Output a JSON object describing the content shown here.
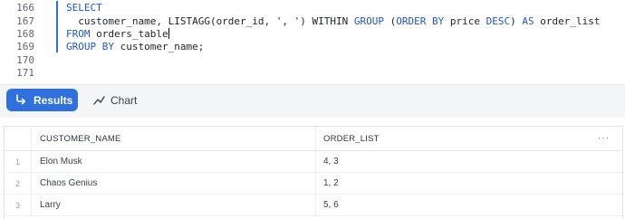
{
  "editor": {
    "line_numbers": [
      "166",
      "167",
      "168",
      "169",
      "170",
      "171"
    ],
    "lines": [
      [
        {
          "t": "SELECT",
          "k": true
        }
      ],
      [
        {
          "t": "  customer_name, LISTAGG(order_id, ', ') WITHIN ",
          "k": false
        },
        {
          "t": "GROUP",
          "k": true
        },
        {
          "t": " (",
          "k": false
        },
        {
          "t": "ORDER",
          "k": true
        },
        {
          "t": " ",
          "k": false
        },
        {
          "t": "BY",
          "k": true
        },
        {
          "t": " price ",
          "k": false
        },
        {
          "t": "DESC",
          "k": true
        },
        {
          "t": ") ",
          "k": false
        },
        {
          "t": "AS",
          "k": true
        },
        {
          "t": " order_list",
          "k": false
        }
      ],
      [
        {
          "t": "FROM",
          "k": true
        },
        {
          "t": " orders_table",
          "k": false
        }
      ],
      [
        {
          "t": "GROUP",
          "k": true
        },
        {
          "t": " ",
          "k": false
        },
        {
          "t": "BY",
          "k": true
        },
        {
          "t": " customer_name;",
          "k": false
        }
      ],
      [],
      []
    ],
    "cursor_line": 2,
    "keyword_color": "#1f57c8"
  },
  "tabs": {
    "results_label": "Results",
    "chart_label": "Chart",
    "active_tab": "Results",
    "accent_color": "#2f6fde"
  },
  "table": {
    "columns": [
      "CUSTOMER_NAME",
      "ORDER_LIST"
    ],
    "more_label": "···",
    "rows": [
      {
        "n": "1",
        "customer_name": "Elon Musk",
        "order_list": "4, 3"
      },
      {
        "n": "2",
        "customer_name": "Chaos Genius",
        "order_list": "1, 2"
      },
      {
        "n": "3",
        "customer_name": "Larry",
        "order_list": "5, 6"
      }
    ]
  }
}
